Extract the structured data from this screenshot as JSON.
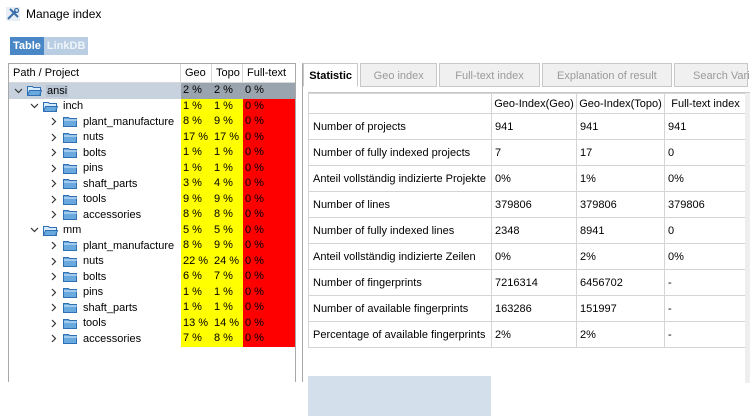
{
  "window": {
    "title": "Manage index"
  },
  "view_toggle": {
    "table": "Table",
    "linkdb": "LinkDB"
  },
  "tree": {
    "headers": {
      "path": "Path / Project",
      "geo": "Geo",
      "topo": "Topo",
      "full": "Full-text"
    },
    "rows": [
      {
        "name": "ansi",
        "geo": "2 %",
        "topo": "2 %",
        "full": "0 %",
        "level": 0,
        "expanded": true,
        "selected": true
      },
      {
        "name": "inch",
        "geo": "1 %",
        "topo": "1 %",
        "full": "0 %",
        "level": 1,
        "expanded": true
      },
      {
        "name": "plant_manufacture",
        "geo": "8 %",
        "topo": "9 %",
        "full": "0 %",
        "level": 2,
        "expanded": false
      },
      {
        "name": "nuts",
        "geo": "17 %",
        "topo": "17 %",
        "full": "0 %",
        "level": 2,
        "expanded": false
      },
      {
        "name": "bolts",
        "geo": "1 %",
        "topo": "1 %",
        "full": "0 %",
        "level": 2,
        "expanded": false
      },
      {
        "name": "pins",
        "geo": "1 %",
        "topo": "1 %",
        "full": "0 %",
        "level": 2,
        "expanded": false
      },
      {
        "name": "shaft_parts",
        "geo": "3 %",
        "topo": "4 %",
        "full": "0 %",
        "level": 2,
        "expanded": false
      },
      {
        "name": "tools",
        "geo": "9 %",
        "topo": "9 %",
        "full": "0 %",
        "level": 2,
        "expanded": false
      },
      {
        "name": "accessories",
        "geo": "8 %",
        "topo": "8 %",
        "full": "0 %",
        "level": 2,
        "expanded": false
      },
      {
        "name": "mm",
        "geo": "5 %",
        "topo": "5 %",
        "full": "0 %",
        "level": 1,
        "expanded": true
      },
      {
        "name": "plant_manufacture",
        "geo": "8 %",
        "topo": "9 %",
        "full": "0 %",
        "level": 2,
        "expanded": false
      },
      {
        "name": "nuts",
        "geo": "22 %",
        "topo": "24 %",
        "full": "0 %",
        "level": 2,
        "expanded": false
      },
      {
        "name": "bolts",
        "geo": "6 %",
        "topo": "7 %",
        "full": "0 %",
        "level": 2,
        "expanded": false
      },
      {
        "name": "pins",
        "geo": "1 %",
        "topo": "1 %",
        "full": "0 %",
        "level": 2,
        "expanded": false
      },
      {
        "name": "shaft_parts",
        "geo": "1 %",
        "topo": "1 %",
        "full": "0 %",
        "level": 2,
        "expanded": false
      },
      {
        "name": "tools",
        "geo": "13 %",
        "topo": "14 %",
        "full": "0 %",
        "level": 2,
        "expanded": false
      },
      {
        "name": "accessories",
        "geo": "7 %",
        "topo": "8 %",
        "full": "0 %",
        "level": 2,
        "expanded": false
      }
    ]
  },
  "tabs": [
    "Statistic",
    "Geo index",
    "Full-text index",
    "Explanation of result",
    "Search Variab"
  ],
  "stats": {
    "columns": [
      "Geo-Index(Geo)",
      "Geo-Index(Topo)",
      "Full-text index"
    ],
    "rows": [
      {
        "label": "Number of projects",
        "values": [
          "941",
          "941",
          "941"
        ]
      },
      {
        "label": "Number of fully indexed projects",
        "values": [
          "7",
          "17",
          "0"
        ]
      },
      {
        "label": "Anteil vollständig indizierte Projekte",
        "values": [
          "0%",
          "1%",
          "0%"
        ]
      },
      {
        "label": "Number of lines",
        "values": [
          "379806",
          "379806",
          "379806"
        ]
      },
      {
        "label": "Number of fully indexed lines",
        "values": [
          "2348",
          "8941",
          "0"
        ]
      },
      {
        "label": "Anteil vollständig indizierte Zeilen",
        "values": [
          "0%",
          "2%",
          "0%"
        ]
      },
      {
        "label": "Number of fingerprints",
        "values": [
          "7216314",
          "6456702",
          "-"
        ]
      },
      {
        "label": "Number of available fingerprints",
        "values": [
          "163286",
          "151997",
          "-"
        ]
      },
      {
        "label": "Percentage of available fingerprints",
        "values": [
          "2%",
          "2%",
          "-"
        ]
      }
    ]
  },
  "colors": {
    "geo": "#ffff00",
    "full": "#ff0000",
    "toggle_active": "#4a87c6",
    "folder": "#6aa9de"
  },
  "icons": {
    "app": "tools-icon",
    "folder": "folder-icon",
    "expanded": "chevron-down-icon",
    "collapsed": "chevron-right-icon"
  }
}
